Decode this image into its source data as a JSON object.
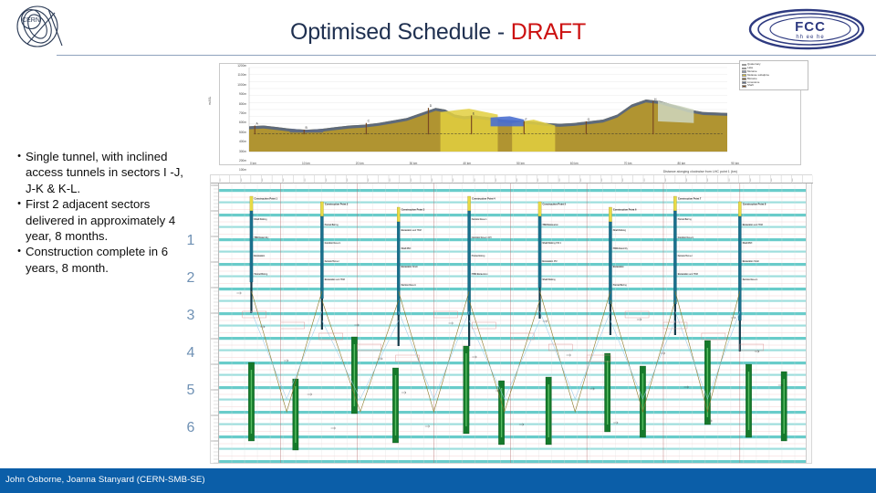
{
  "header": {
    "title_main": "Optimised Schedule - ",
    "title_draft": "DRAFT",
    "cern_logo_text": "CERN",
    "fcc_logo_text": "FCC",
    "fcc_logo_sub": "hh ee he",
    "accent_navy": "#1f3050",
    "accent_red": "#cc1111"
  },
  "bullets": [
    {
      "marker": "•",
      "text": "Single tunnel, with inclined access tunnels in sectors I -J, J-K & K-L."
    },
    {
      "marker": "•",
      "text": "First 2 adjacent sectors delivered in approximately 4 year, 8 months."
    },
    {
      "marker": "•",
      "text": "Construction complete in 6 years, 8 month."
    }
  ],
  "years": {
    "color": "#6f91b4",
    "labels": [
      "1",
      "2",
      "3",
      "4",
      "5",
      "6"
    ]
  },
  "geology": {
    "ylabel": "m ASL",
    "xlabel": "Distance alonging clockwise from LHC point 1 (km)",
    "y_ticks": [
      "1200m",
      "1100m",
      "1000m",
      "900m",
      "800m",
      "700m",
      "600m",
      "500m",
      "400m",
      "300m",
      "200m",
      "100m",
      "0m"
    ],
    "x_ticks": [
      "0 km",
      "10 km",
      "20 km",
      "30 km",
      "40 km",
      "50 km",
      "60 km",
      "70 km",
      "80 km",
      "90 km"
    ],
    "shaft_labels": [
      "A",
      "B",
      "C",
      "D",
      "E",
      "F",
      "G",
      "H"
    ],
    "legend": [
      {
        "label": "Quaternary",
        "color": "#b9a96a"
      },
      {
        "label": "Lake",
        "color": "#3f63c7"
      },
      {
        "label": "Moraine",
        "color": "#8d9ab4"
      },
      {
        "label": "Molasse subalpine",
        "color": "#d9c23a"
      },
      {
        "label": "Bloraine",
        "color": "#8a6a3c"
      },
      {
        "label": "Limestone",
        "color": "#5d6b88"
      },
      {
        "label": "Shaft",
        "color": "#7a4a22"
      }
    ],
    "colors": {
      "molasse": "#b09431",
      "molasse_light": "#c9ae4a",
      "limestone": "#5a6780",
      "lake": "#4a6fd0",
      "yellow_lens": "#e2cf3f",
      "pale_lens": "#cfd7bf",
      "shaft": "#7a4a22",
      "dashed_tunnel": "#2a2a2a"
    }
  },
  "gantt": {
    "title": "Optimised Schedule",
    "band_color": "#4fc3c1",
    "grid_color": "#e8b3b3",
    "green_bar_color": "#157a2b",
    "green_bar_inner": "#63c96b",
    "shaft_line_color": "#1a6f8c",
    "shaft_cap_color": "#e8dc45",
    "link_color": "#8a7a2a",
    "link_blue": "#8fc6e8",
    "header_ticks": 56,
    "phase_labels": [
      "Construction Point 1",
      "Construction Point 2",
      "Construction Point 3",
      "Construction Point 4",
      "Construction Point 5",
      "Construction Point 6",
      "Construction Point 7",
      "Construction Point 8"
    ],
    "task_labels": [
      "Shaft Sinking",
      "TBM Assembly",
      "Excavation",
      "Tunnel Boring",
      "Junction Cavern",
      "Access Tunnel",
      "Excavation and TBM",
      "Shaft PM",
      "Excavation Shaft",
      "Service Cavern",
      "Junction Cavern RH",
      "Tunnel Lining",
      "TBM Excavation",
      "Shaft Sinking PM 4",
      "Excavation PM"
    ],
    "year_markers": [
      "1",
      "2",
      "3",
      "4",
      "5",
      "6"
    ]
  },
  "footer": {
    "text": "John Osborne, Joanna Stanyard (CERN-SMB-SE)",
    "bg_color": "#0b5ea8"
  }
}
